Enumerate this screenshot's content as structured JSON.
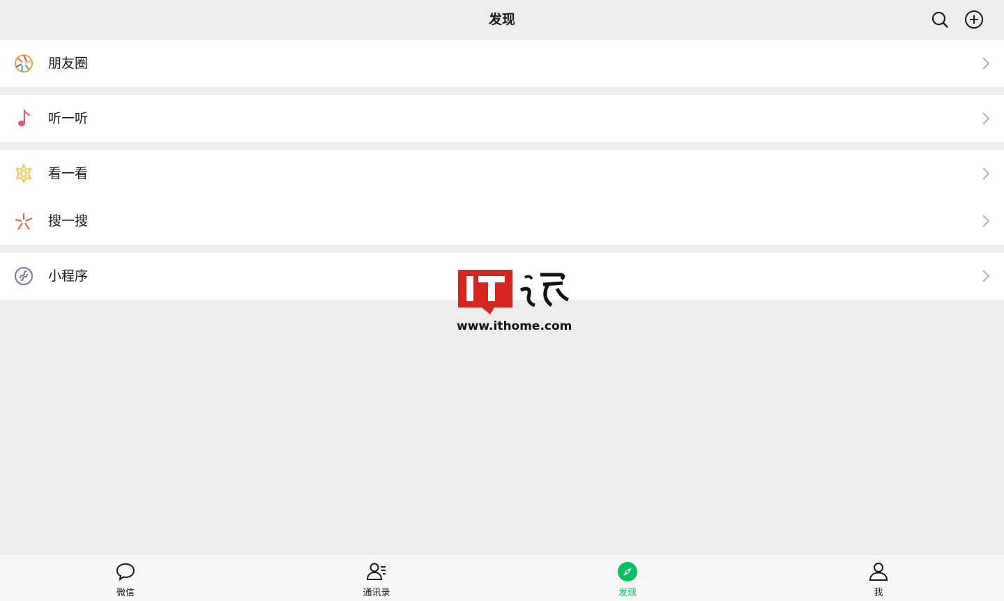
{
  "header": {
    "title": "发现",
    "search_icon": "search-icon",
    "add_icon": "add-circle-icon"
  },
  "menu": [
    {
      "label": "朋友圈",
      "icon": "moments-aperture-icon",
      "color": "#f3a33a"
    },
    {
      "label": "听一听",
      "icon": "music-note-icon",
      "color": "#e2576b"
    },
    {
      "label": "看一看",
      "icon": "top-stories-icon",
      "color": "#f5c53c"
    },
    {
      "label": "搜一搜",
      "icon": "search-spark-icon",
      "color": "#e65e59"
    },
    {
      "label": "小程序",
      "icon": "mini-program-icon",
      "color": "#7d6fb4"
    }
  ],
  "watermark": {
    "logo_text": "IT之家",
    "url": "www.ithome.com"
  },
  "tabbar": {
    "accent": "#07c160",
    "tabs": [
      {
        "label": "微信",
        "icon": "chat-bubble-icon"
      },
      {
        "label": "通讯录",
        "icon": "contacts-icon"
      },
      {
        "label": "发现",
        "icon": "compass-icon",
        "active": true
      },
      {
        "label": "我",
        "icon": "person-icon"
      }
    ]
  }
}
